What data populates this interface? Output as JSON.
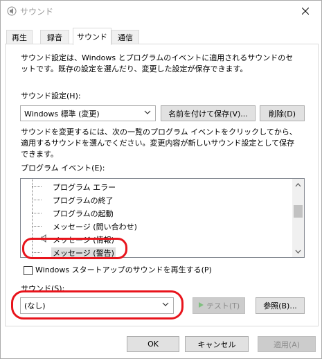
{
  "window": {
    "title": "サウンド"
  },
  "tabs": [
    {
      "label": "再生"
    },
    {
      "label": "録音"
    },
    {
      "label": "サウンド"
    },
    {
      "label": "通信"
    }
  ],
  "sound_tab": {
    "description": "サウンド設定は、Windows とプログラムのイベントに適用されるサウンドのセットです。既存の設定を選んだり、変更した設定が保存できます。",
    "scheme_label": "サウンド設定(H):",
    "scheme_value": "Windows 標準 (変更)",
    "save_as_button": "名前を付けて保存(V)...",
    "delete_button": "削除(D)",
    "instructions": "サウンドを変更するには、次の一覧のプログラム イベントをクリックしてから、適用するサウンドを選んでください。変更内容が新しいサウンド設定として保存できます。",
    "events_label": "プログラム イベント(E):",
    "events": [
      {
        "label": "プログラム エラー"
      },
      {
        "label": "プログラムの終了"
      },
      {
        "label": "プログラムの起動"
      },
      {
        "label": "メッセージ (問い合わせ)"
      },
      {
        "label": "メッセージ (情報)"
      },
      {
        "label": "メッセージ (警告)",
        "selected": true
      }
    ],
    "startup_checkbox_label": "Windows スタートアップのサウンドを再生する(P)",
    "startup_checked": false,
    "sounds_label": "サウンド(S):",
    "sound_value": "(なし)",
    "test_button": "テスト(T)",
    "browse_button": "参照(B)..."
  },
  "footer": {
    "ok": "OK",
    "cancel": "キャンセル",
    "apply": "適用(A)"
  },
  "colors": {
    "highlight": "#e8141c",
    "selected_bg": "#dddddd",
    "title_text": "#9a9a9a"
  }
}
